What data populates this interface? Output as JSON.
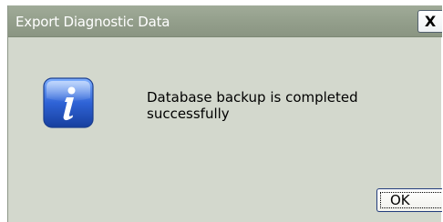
{
  "dialog": {
    "title": "Export Diagnostic Data",
    "close_label": "X",
    "icon": "info-icon",
    "message": "Database backup is completed successfully",
    "ok_label": "OK"
  },
  "colors": {
    "titlebar": "#939e8b",
    "body": "#d3d8cd",
    "icon_blue": "#2f63d6"
  }
}
